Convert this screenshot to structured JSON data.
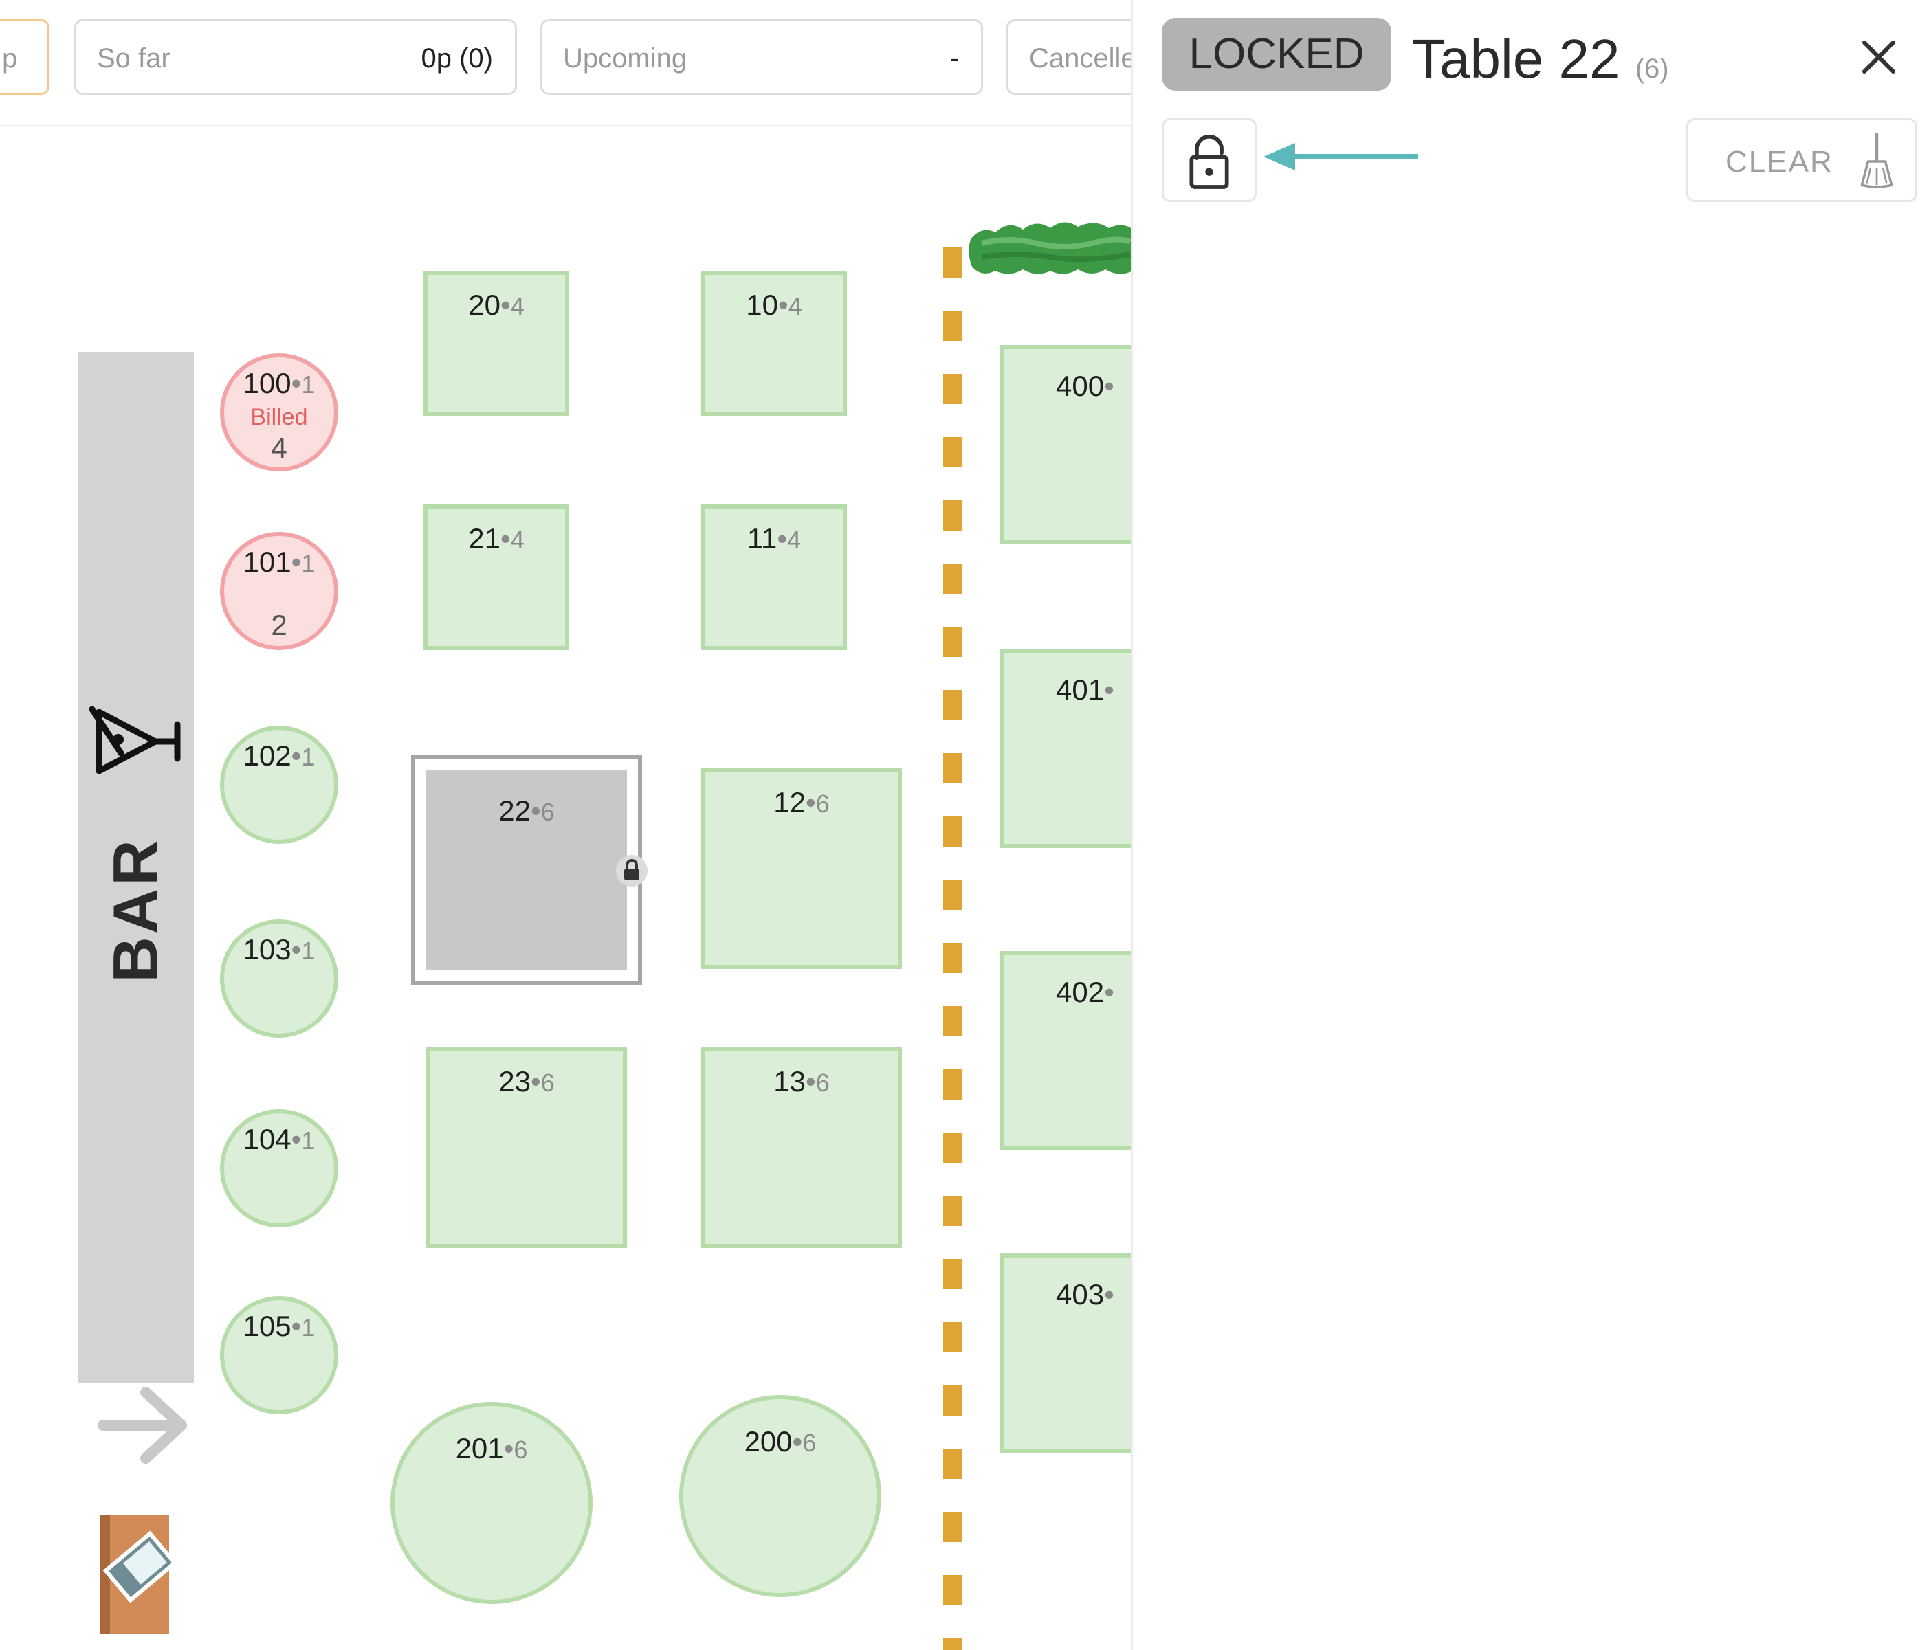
{
  "summary_bar": {
    "pill_0": {
      "label": "p"
    },
    "so_far": {
      "label": "So far",
      "value": "0p (0)"
    },
    "upcoming": {
      "label": "Upcoming",
      "value": "-"
    },
    "cancelled": {
      "label": "Cancelle"
    }
  },
  "floor_plan": {
    "bar_label": "BAR",
    "tables": [
      {
        "name": "100",
        "sep": "•",
        "capacity": "1",
        "status": "Billed",
        "guests": "4"
      },
      {
        "name": "101",
        "sep": "•",
        "capacity": "1",
        "guests": "2"
      },
      {
        "name": "102",
        "sep": "•",
        "capacity": "1"
      },
      {
        "name": "103",
        "sep": "•",
        "capacity": "1"
      },
      {
        "name": "104",
        "sep": "•",
        "capacity": "1"
      },
      {
        "name": "105",
        "sep": "•",
        "capacity": "1"
      },
      {
        "name": "20",
        "sep": "•",
        "capacity": "4"
      },
      {
        "name": "21",
        "sep": "•",
        "capacity": "4"
      },
      {
        "name": "22",
        "sep": "•",
        "capacity": "6"
      },
      {
        "name": "23",
        "sep": "•",
        "capacity": "6"
      },
      {
        "name": "10",
        "sep": "•",
        "capacity": "4"
      },
      {
        "name": "11",
        "sep": "•",
        "capacity": "4"
      },
      {
        "name": "12",
        "sep": "•",
        "capacity": "6"
      },
      {
        "name": "13",
        "sep": "•",
        "capacity": "6"
      },
      {
        "name": "201",
        "sep": "•",
        "capacity": "6"
      },
      {
        "name": "200",
        "sep": "•",
        "capacity": "6"
      },
      {
        "name": "400",
        "sep": "•"
      },
      {
        "name": "401",
        "sep": "•"
      },
      {
        "name": "402",
        "sep": "•"
      },
      {
        "name": "403",
        "sep": "•"
      }
    ]
  },
  "panel": {
    "badge": "LOCKED",
    "title": "Table 22",
    "capacity": "(6)",
    "clear_label": "CLEAR",
    "icons": {
      "close": "close-icon",
      "lock": "unlock-icon",
      "clear": "broom-icon",
      "pointer": "arrow-left-icon"
    }
  },
  "colors": {
    "table_fill": "#dbeed7",
    "table_border": "#b5dca9",
    "billed_fill": "#fbdede",
    "billed_border": "#f3a3a6",
    "billed_text": "#e0605f",
    "locked_fill": "#c8c8c8",
    "divider": "#dfa431",
    "pointer_arrow": "#5bb8bb",
    "hedge": "#3c9a45"
  }
}
